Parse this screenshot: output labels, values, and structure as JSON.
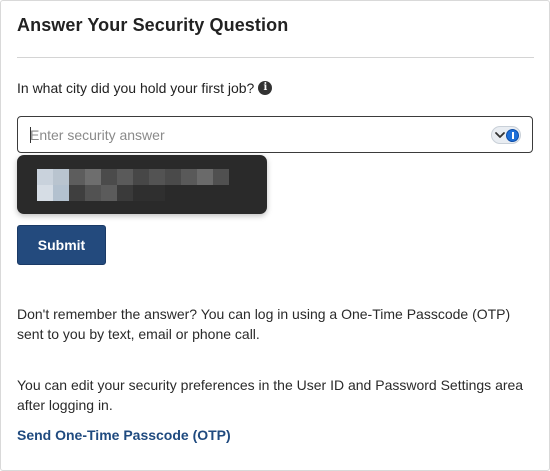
{
  "header": {
    "title": "Answer Your Security Question"
  },
  "question": {
    "text": "In what city did you hold your first job?",
    "info_icon": "info-icon"
  },
  "answer_field": {
    "value": "",
    "placeholder": "Enter security answer",
    "toggle_icon": "password-manager-icon"
  },
  "autofill_popup": {
    "content": "redacted-suggestion",
    "colors": {
      "background": "#2a2a2a"
    }
  },
  "actions": {
    "submit_label": "Submit"
  },
  "help": {
    "otp_text": "Don't remember the answer? You can log in using a One-Time Passcode (OTP) sent to you by text, email or phone call.",
    "preferences_text": "You can edit your security preferences in the User ID and Password Settings area after logging in.",
    "otp_link_label": "Send One-Time Passcode (OTP)"
  },
  "colors": {
    "primary_button": "#234a7d",
    "link": "#1f4a7f",
    "text": "#2a2a2a",
    "divider": "#d4d4d4"
  }
}
